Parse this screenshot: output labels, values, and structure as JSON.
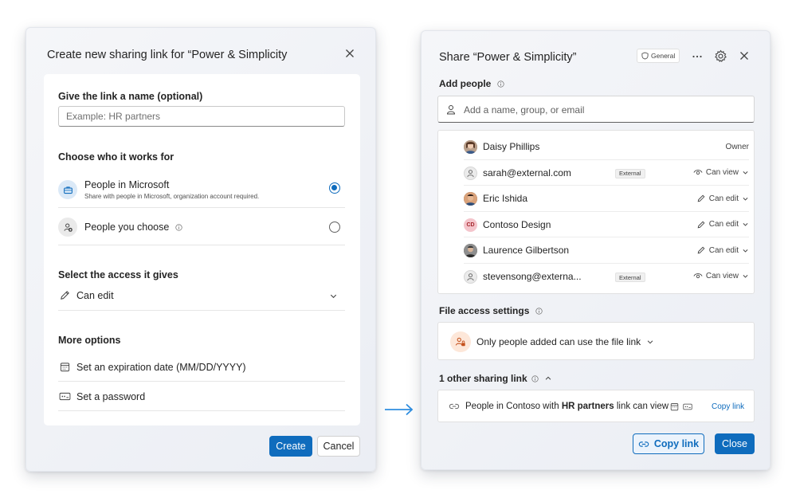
{
  "left_dialog": {
    "title": "Create new sharing link for “Power & Simplicity",
    "name_section": {
      "label": "Give the link a name (optional)",
      "placeholder": "Example: HR partners",
      "value": ""
    },
    "who_section": {
      "label": "Choose who it works for",
      "options": [
        {
          "title": "People in Microsoft",
          "subtitle": "Share with people in Microsoft, organization account required.",
          "selected": true,
          "icon": "briefcase-icon"
        },
        {
          "title": "People you choose",
          "subtitle": "",
          "selected": false,
          "icon": "person-add-icon"
        }
      ]
    },
    "access_section": {
      "label": "Select the access it gives",
      "value": "Can edit"
    },
    "more_options": {
      "label": "More options",
      "items": [
        {
          "label": "Set an expiration date (MM/DD/YYYY)",
          "icon": "calendar-icon"
        },
        {
          "label": "Set a password",
          "icon": "password-icon"
        }
      ]
    },
    "buttons": {
      "create": "Create",
      "cancel": "Cancel"
    }
  },
  "right_dialog": {
    "title": "Share “Power & Simplicity”",
    "sensitivity_badge": "General",
    "add_people": {
      "label": "Add people",
      "placeholder": "Add a name, group, or email"
    },
    "people": [
      {
        "name": "Daisy Phillips",
        "external": false,
        "permission": "Owner",
        "avatar": "photo",
        "color": "#8a6a55"
      },
      {
        "name": "sarah@external.com",
        "external": true,
        "permission": "Can view",
        "avatar": "generic",
        "color": "#e8e8e8"
      },
      {
        "name": "Eric Ishida",
        "external": false,
        "permission": "Can edit",
        "avatar": "photo",
        "color": "#6a4a3a"
      },
      {
        "name": "Contoso Design",
        "external": false,
        "permission": "Can edit",
        "avatar": "initials",
        "initials": "CD",
        "color": "#f0c0c8"
      },
      {
        "name": "Laurence Gilbertson",
        "external": false,
        "permission": "Can edit",
        "avatar": "photo",
        "color": "#5a5a5a"
      },
      {
        "name": "stevensong@externa...",
        "external": true,
        "permission": "Can view",
        "avatar": "generic",
        "color": "#e8e8e8"
      }
    ],
    "external_label": "External",
    "file_access": {
      "label": "File access settings",
      "value": "Only people added can use the file link"
    },
    "other_links": {
      "label": "1 other sharing link",
      "link_text_pre": "People in Contoso with ",
      "link_text_bold": "HR partners",
      "link_text_post": " link can view",
      "copy": "Copy link"
    },
    "buttons": {
      "copy_link": "Copy link",
      "close": "Close"
    }
  },
  "colors": {
    "accent": "#0f6cbd",
    "arrow": "#2f8ee0"
  }
}
